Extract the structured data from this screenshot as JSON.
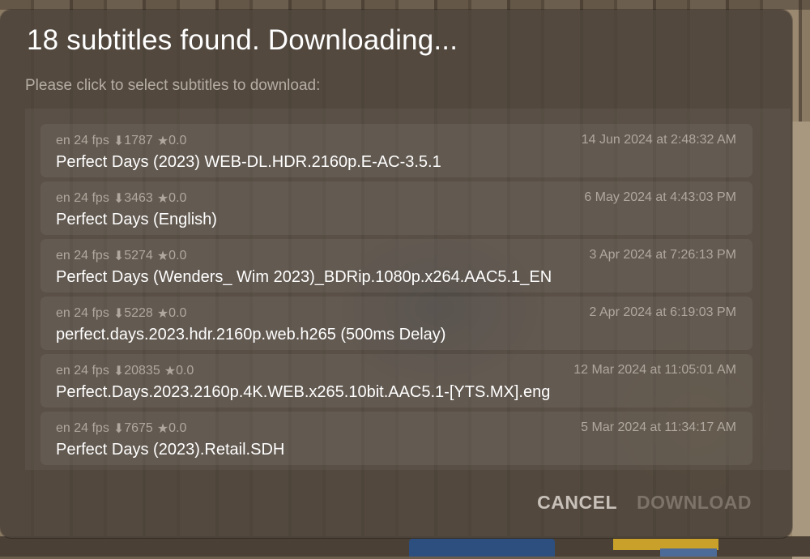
{
  "dialog": {
    "title": "18 subtitles found. Downloading...",
    "instruction": "Please click to select subtitles to download:",
    "cancel_label": "CANCEL",
    "download_label": "DOWNLOAD"
  },
  "icons": {
    "downloads": "download-arrow-icon",
    "rating": "star-icon"
  },
  "subtitles": [
    {
      "lang_fps": "en 24 fps",
      "downloads": "1787",
      "rating": "0.0",
      "date": "14 Jun 2024 at 2:48:32 AM",
      "name": "Perfect Days (2023) WEB-DL.HDR.2160p.E-AC-3.5.1"
    },
    {
      "lang_fps": "en 24 fps",
      "downloads": "3463",
      "rating": "0.0",
      "date": "6 May 2024 at 4:43:03 PM",
      "name": "Perfect Days (English)"
    },
    {
      "lang_fps": "en 24 fps",
      "downloads": "5274",
      "rating": "0.0",
      "date": "3 Apr 2024 at 7:26:13 PM",
      "name": "Perfect Days (Wenders_ Wim 2023)_BDRip.1080p.x264.AAC5.1_EN"
    },
    {
      "lang_fps": "en 24 fps",
      "downloads": "5228",
      "rating": "0.0",
      "date": "2 Apr 2024 at 6:19:03 PM",
      "name": "perfect.days.2023.hdr.2160p.web.h265 (500ms Delay)"
    },
    {
      "lang_fps": "en 24 fps",
      "downloads": "20835",
      "rating": "0.0",
      "date": "12 Mar 2024 at 11:05:01 AM",
      "name": "Perfect.Days.2023.2160p.4K.WEB.x265.10bit.AAC5.1-[YTS.MX].eng"
    },
    {
      "lang_fps": "en 24 fps",
      "downloads": "7675",
      "rating": "0.0",
      "date": "5 Mar 2024 at 11:34:17 AM",
      "name": "Perfect Days (2023).Retail.SDH"
    }
  ]
}
